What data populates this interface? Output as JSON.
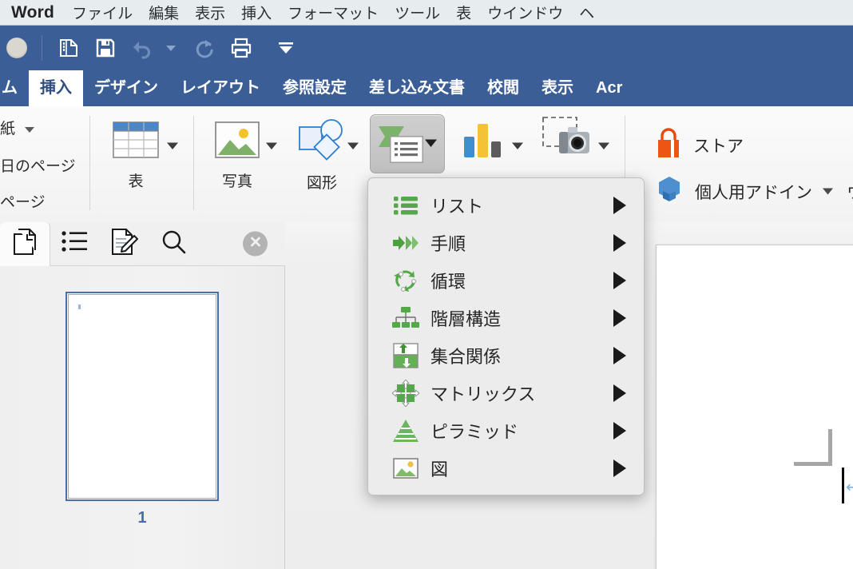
{
  "menubar": {
    "app_name": "Word",
    "items": [
      {
        "label": "ファイル",
        "name": "menu-file"
      },
      {
        "label": "編集",
        "name": "menu-edit"
      },
      {
        "label": "表示",
        "name": "menu-view"
      },
      {
        "label": "挿入",
        "name": "menu-insert"
      },
      {
        "label": "フォーマット",
        "name": "menu-format"
      },
      {
        "label": "ツール",
        "name": "menu-tools"
      },
      {
        "label": "表",
        "name": "menu-table"
      },
      {
        "label": "ウインドウ",
        "name": "menu-window"
      },
      {
        "label": "ヘ",
        "name": "menu-help-clipped"
      }
    ]
  },
  "quick_access": {
    "items": [
      {
        "icon": "sidebar-toggle-icon",
        "name": "qat-sidebar-toggle"
      },
      {
        "icon": "save-icon",
        "name": "qat-save"
      },
      {
        "icon": "undo-icon",
        "name": "qat-undo"
      },
      {
        "icon": "undo-dropdown-caret",
        "name": "qat-undo-caret"
      },
      {
        "icon": "redo-icon",
        "name": "qat-redo"
      },
      {
        "icon": "print-icon",
        "name": "qat-print"
      },
      {
        "icon": "overflow-caret-icon",
        "name": "qat-overflow"
      }
    ]
  },
  "ribbon_tabs": {
    "items": [
      {
        "label": "ム",
        "active": false,
        "name": "tab-home-clipped"
      },
      {
        "label": "挿入",
        "active": true,
        "name": "tab-insert"
      },
      {
        "label": "デザイン",
        "active": false,
        "name": "tab-design"
      },
      {
        "label": "レイアウト",
        "active": false,
        "name": "tab-layout"
      },
      {
        "label": "参照設定",
        "active": false,
        "name": "tab-references"
      },
      {
        "label": "差し込み文書",
        "active": false,
        "name": "tab-mailings"
      },
      {
        "label": "校閲",
        "active": false,
        "name": "tab-review"
      },
      {
        "label": "表示",
        "active": false,
        "name": "tab-view"
      },
      {
        "label": "Acr",
        "active": false,
        "name": "tab-acrobat-clipped"
      }
    ]
  },
  "ribbon": {
    "pages_group": {
      "item1": "紙",
      "item2": "日のページ",
      "item3": "ページ"
    },
    "table_label": "表",
    "picture_label": "写真",
    "shapes_label": "図形",
    "store_label": "ストア",
    "addins_label": "個人用アドイン",
    "wikipedia_label": "ウィ"
  },
  "smartart_menu": {
    "items": [
      {
        "label": "リスト",
        "icon": "list-icon",
        "name": "smartart-list"
      },
      {
        "label": "手順",
        "icon": "process-icon",
        "name": "smartart-process"
      },
      {
        "label": "循環",
        "icon": "cycle-icon",
        "name": "smartart-cycle"
      },
      {
        "label": "階層構造",
        "icon": "hierarchy-icon",
        "name": "smartart-hierarchy"
      },
      {
        "label": "集合関係",
        "icon": "relationship-icon",
        "name": "smartart-relationship"
      },
      {
        "label": "マトリックス",
        "icon": "matrix-icon",
        "name": "smartart-matrix"
      },
      {
        "label": "ピラミッド",
        "icon": "pyramid-icon",
        "name": "smartart-pyramid"
      },
      {
        "label": "図",
        "icon": "picture-icon",
        "name": "smartart-picture"
      }
    ]
  },
  "nav_pane": {
    "tabs": [
      {
        "icon": "thumbnail-pages-icon",
        "active": true,
        "name": "navtab-thumbnails"
      },
      {
        "icon": "document-map-icon",
        "active": false,
        "name": "navtab-document-map"
      },
      {
        "icon": "review-edits-icon",
        "active": false,
        "name": "navtab-reviewing"
      },
      {
        "icon": "search-icon",
        "active": false,
        "name": "navtab-search"
      }
    ],
    "close_icon": "close-icon",
    "page_number": "1"
  },
  "colors": {
    "ribbon_blue": "#3b5e96",
    "menubar_bg": "#e7edee",
    "accent_green": "#5aa84f",
    "store_orange": "#e8490f",
    "addin_blue": "#3a7ec4",
    "page_number_blue": "#4a6ea8",
    "pilcrow_blue": "#7cb4e8"
  }
}
